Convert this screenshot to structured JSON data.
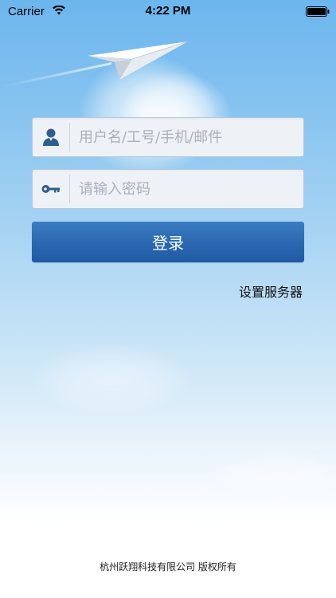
{
  "status_bar": {
    "carrier": "Carrier",
    "time": "4:22 PM"
  },
  "login": {
    "username_placeholder": "用户名/工号/手机/邮件",
    "password_placeholder": "请输入密码",
    "submit_label": "登录",
    "server_settings_label": "设置服务器"
  },
  "footer": {
    "copyright": "杭州跃翔科技有限公司 版权所有"
  },
  "icons": {
    "user": "user-icon",
    "key": "key-icon",
    "plane": "paper-plane-icon",
    "wifi": "wifi-icon",
    "battery": "battery-icon"
  },
  "colors": {
    "accent": "#2a67b0",
    "sky_top": "#6cb6ee",
    "icon": "#2e5e8e"
  }
}
